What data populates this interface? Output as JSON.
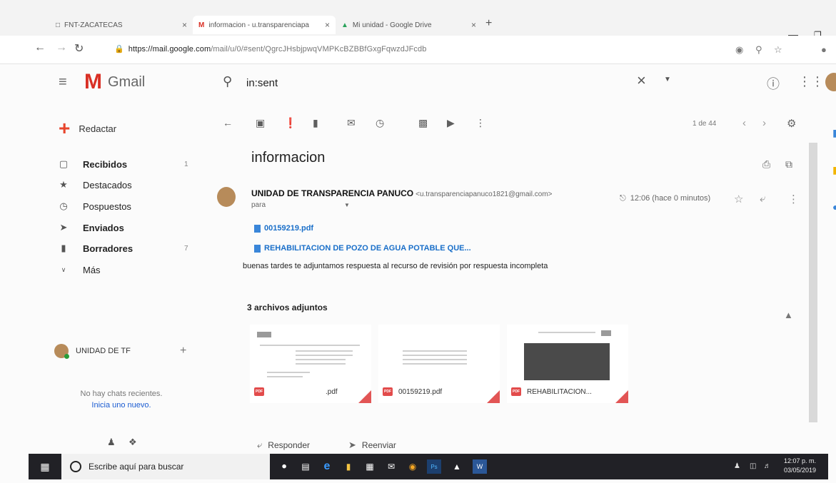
{
  "browser": {
    "tabs": [
      {
        "title": "FNT-ZACATECAS"
      },
      {
        "title": "informacion - u.transparenciapa"
      },
      {
        "title": "Mi unidad - Google Drive"
      }
    ],
    "url_host": "https://mail.google.com",
    "url_path": "/mail/u/0/#sent/QgrcJHsbjpwqVMPKcBZBBfGxgFqwzdJFcdb"
  },
  "gmail": {
    "logo_text": "Gmail",
    "search_value": "in:sent"
  },
  "sidebar": {
    "compose_label": "Redactar",
    "items": [
      {
        "label": "Recibidos",
        "count": "1",
        "icon": "inbox-icon"
      },
      {
        "label": "Destacados",
        "count": "",
        "icon": "star-icon"
      },
      {
        "label": "Pospuestos",
        "count": "",
        "icon": "clock-icon"
      },
      {
        "label": "Enviados",
        "count": "",
        "icon": "send-icon"
      },
      {
        "label": "Borradores",
        "count": "7",
        "icon": "draft-icon"
      },
      {
        "label": "Más",
        "count": "",
        "icon": "chevron-down-icon"
      }
    ],
    "chat_user": "UNIDAD DE TF",
    "no_chats": "No hay chats recientes.",
    "start_chat": "Inicia uno nuevo."
  },
  "pager": {
    "text": "1 de 44"
  },
  "message": {
    "subject": "informacion",
    "sender_name": "UNIDAD DE TRANSPARENCIA PANUCO",
    "sender_email": "<u.transparenciapanuco1821@gmail.com>",
    "to_label": "para",
    "time": "12:06 (hace 0 minutos)",
    "links": [
      "00159219.pdf",
      "REHABILITACION DE POZO DE AGUA POTABLE QUE..."
    ],
    "body": "buenas tardes te adjuntamos respuesta al recurso de revisión por respuesta incompleta",
    "attachments_title": "3 archivos adjuntos",
    "attachments": [
      {
        "name": ".pdf"
      },
      {
        "name": "00159219.pdf"
      },
      {
        "name": "REHABILITACION..."
      }
    ],
    "reply_label": "Responder",
    "forward_label": "Reenviar"
  },
  "taskbar": {
    "search_placeholder": "Escribe aquí para buscar",
    "clock_time": "12:07 p. m.",
    "clock_date": "03/05/2019"
  },
  "colors": {
    "gmail_red": "#d93025",
    "link_blue": "#1a6fc9",
    "taskbar": "#212126"
  }
}
